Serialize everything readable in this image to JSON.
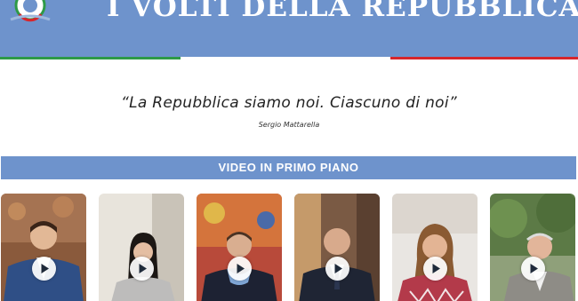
{
  "header": {
    "title": "I VOLTI DELLA REPUBBLICA",
    "logo_icon": "republic-emblem-icon",
    "background": "#6e93cc"
  },
  "flag_colors": [
    "#2e9a47",
    "#ffffff",
    "#d7262c"
  ],
  "quote": {
    "text": "“La Repubblica siamo noi. Ciascuno di noi”",
    "author": "Sergio Mattarella"
  },
  "section": {
    "title": "VIDEO IN PRIMO PIANO"
  },
  "videos": [
    {
      "icon": "play-icon"
    },
    {
      "icon": "play-icon"
    },
    {
      "icon": "play-icon"
    },
    {
      "icon": "play-icon"
    },
    {
      "icon": "play-icon"
    },
    {
      "icon": "play-icon"
    }
  ]
}
